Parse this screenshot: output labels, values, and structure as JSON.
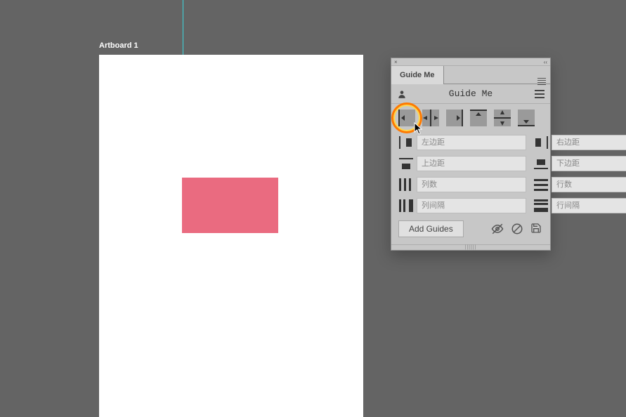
{
  "artboard": {
    "label": "Artboard 1"
  },
  "panel": {
    "tab_label": "Guide Me",
    "header_title": "Guide Me",
    "fields": {
      "left_margin": "左边距",
      "right_margin": "右边距",
      "top_margin": "上边距",
      "bottom_margin": "下边距",
      "columns": "列数",
      "rows": "行数",
      "col_gap": "列间隔",
      "row_gap": "行间隔"
    },
    "actions": {
      "add_guides": "Add Guides"
    }
  }
}
